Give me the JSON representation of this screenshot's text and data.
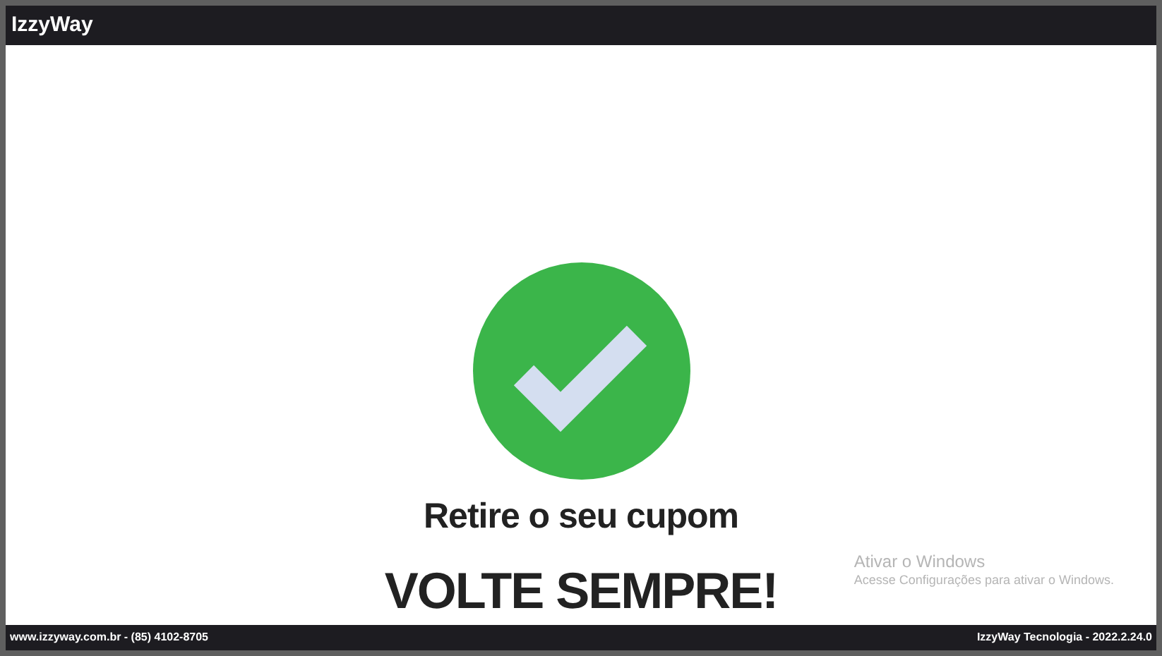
{
  "header": {
    "title": "IzzyWay"
  },
  "message": {
    "instruction": "Retire o seu cupom",
    "farewell": "VOLTE SEMPRE!"
  },
  "windows_notice": {
    "title": "Ativar o Windows",
    "text": "Acesse Configurações para ativar o Windows."
  },
  "footer": {
    "contact": "www.izzyway.com.br - (85) 4102-8705",
    "version": "IzzyWay Tecnologia - 2022.2.24.0"
  }
}
